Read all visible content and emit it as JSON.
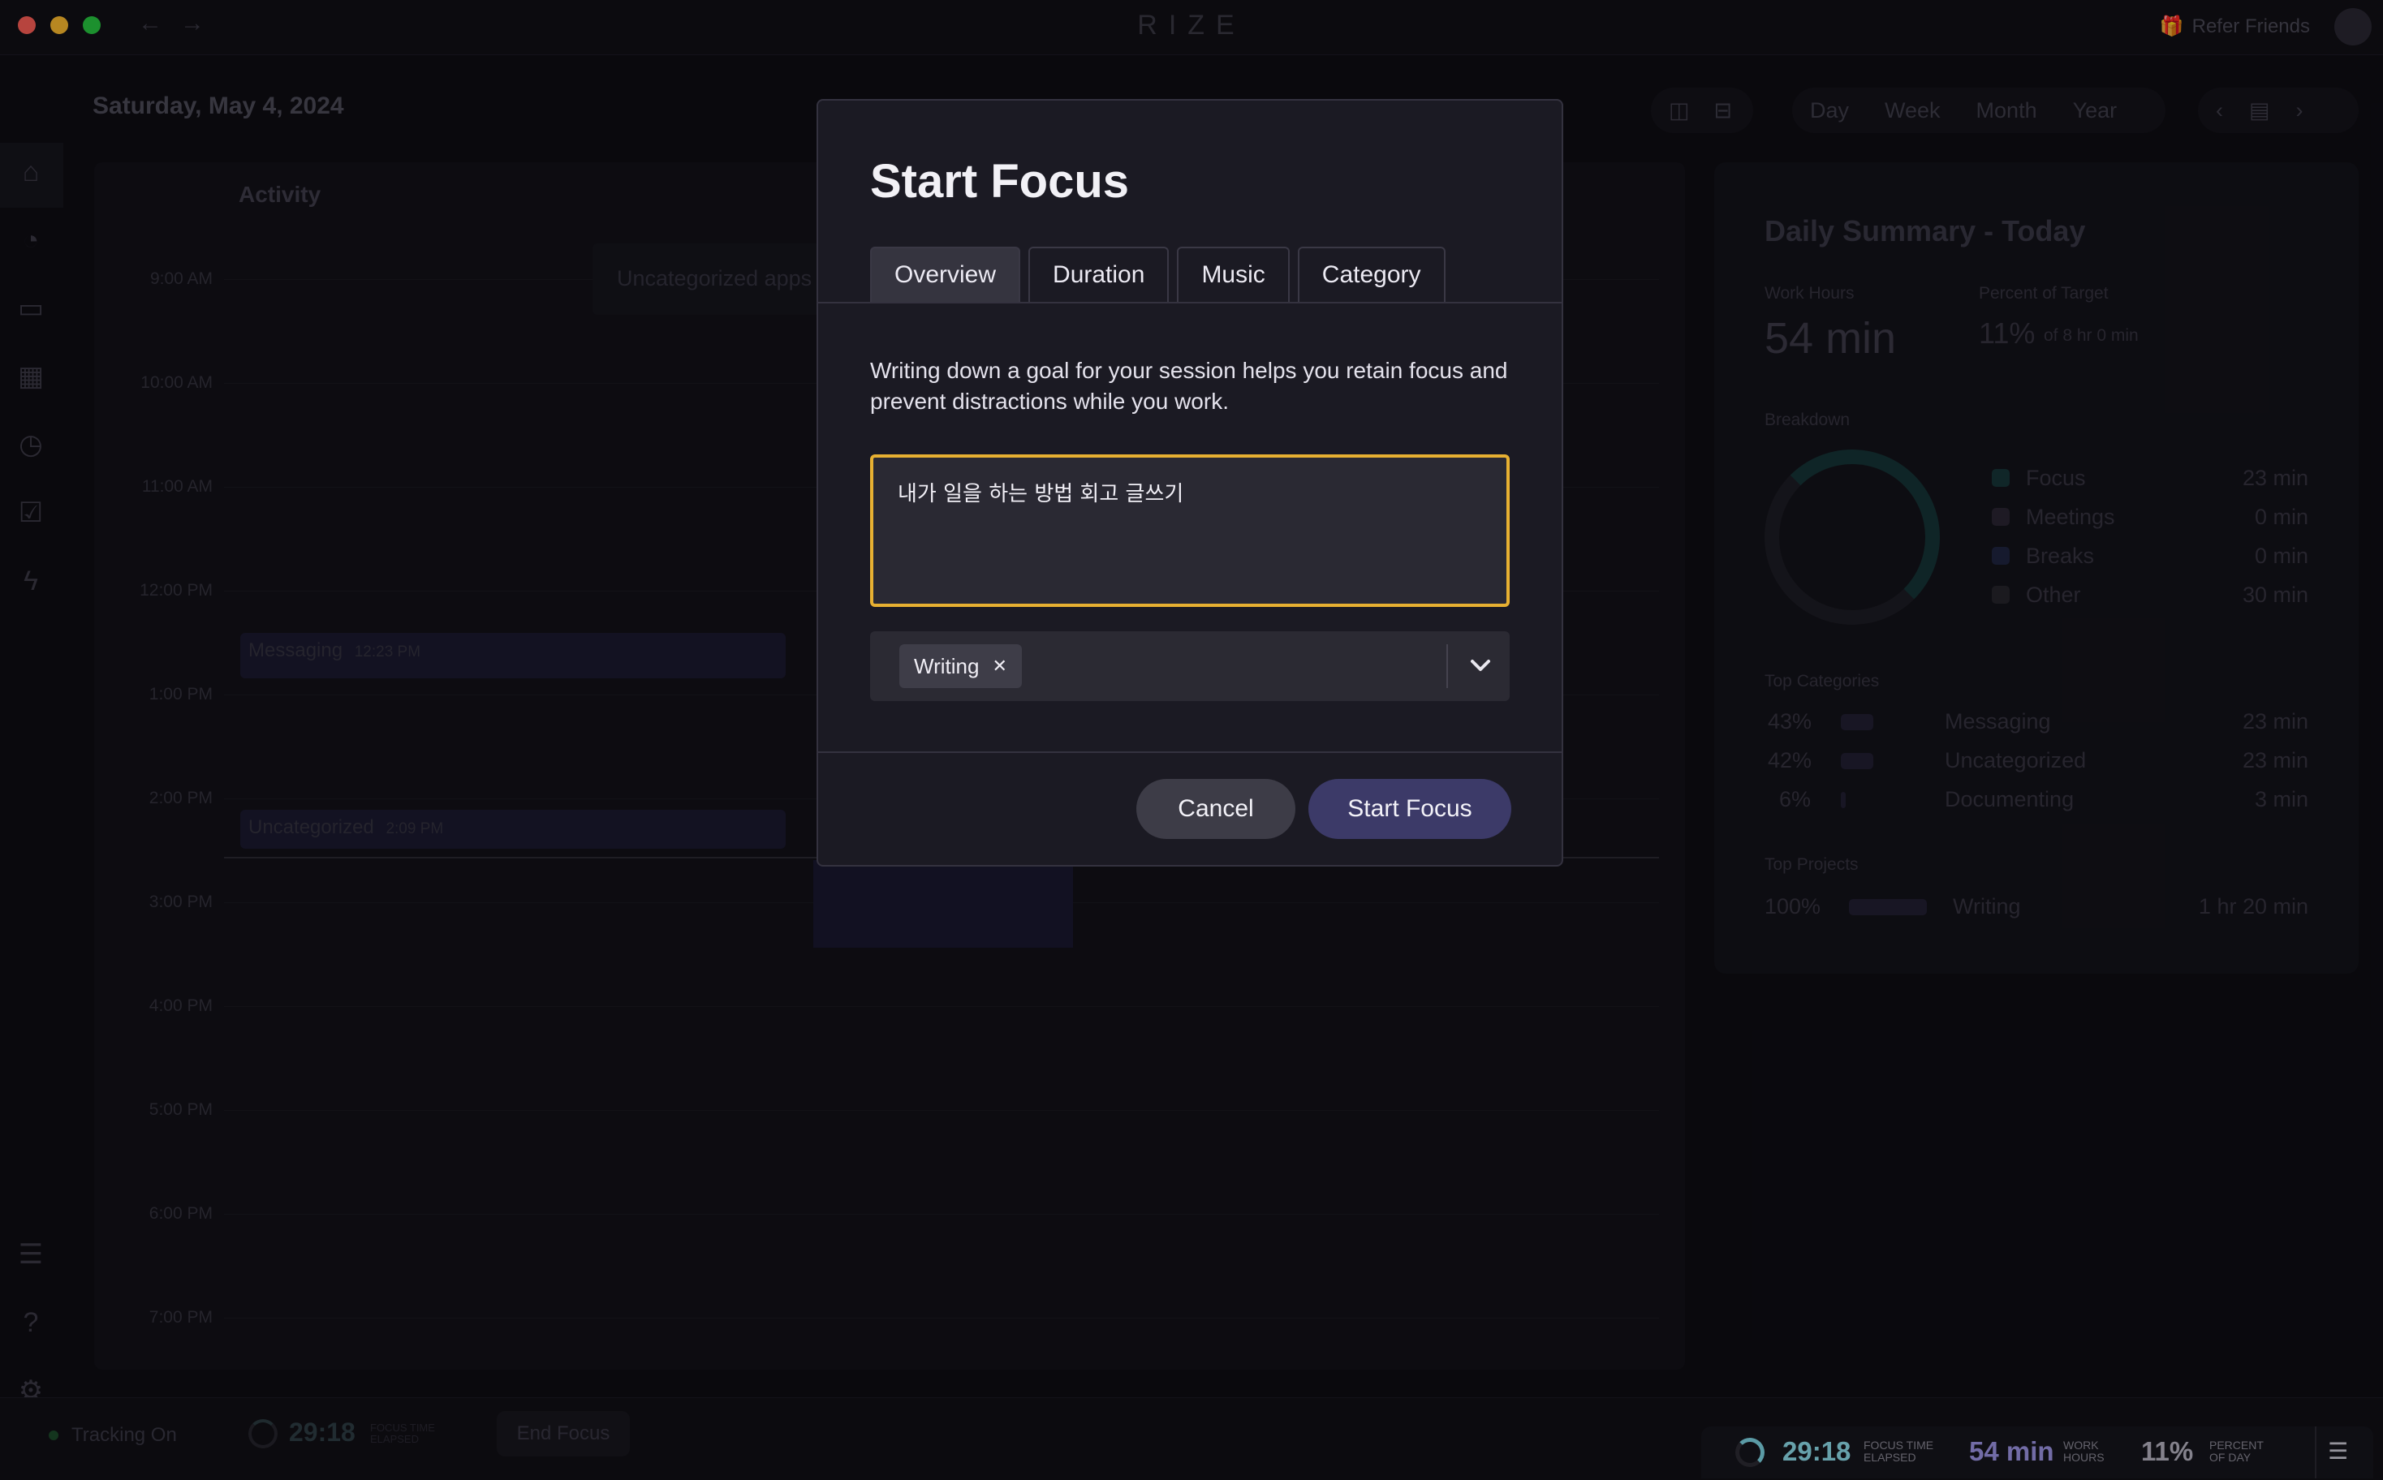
{
  "app": {
    "brand": "RIZE",
    "refer_label": "Refer Friends"
  },
  "header": {
    "date": "Saturday, May 4, 2024",
    "ranges": [
      "Day",
      "Week",
      "Month",
      "Year"
    ]
  },
  "calendar": {
    "activity_label": "Activity",
    "hours": [
      "9:00 AM",
      "10:00 AM",
      "11:00 AM",
      "12:00 PM",
      "1:00 PM",
      "2:00 PM",
      "3:00 PM",
      "4:00 PM",
      "5:00 PM",
      "6:00 PM",
      "7:00 PM"
    ],
    "events": [
      {
        "label": "Uncategorized apps",
        "time": ""
      },
      {
        "label": "Messaging",
        "time": "12:23 PM"
      },
      {
        "label": "Uncategorized",
        "time": "2:09 PM"
      }
    ]
  },
  "summary": {
    "title": "Daily Summary - Today",
    "work_hours_label": "Work Hours",
    "work_hours_value": "54 min",
    "percent_label": "Percent of Target",
    "percent_value": "11%",
    "percent_of": "of 8 hr 0 min",
    "breakdown_label": "Breakdown",
    "breakdown": [
      {
        "name": "Focus",
        "value": "23 min"
      },
      {
        "name": "Meetings",
        "value": "0 min"
      },
      {
        "name": "Breaks",
        "value": "0 min"
      },
      {
        "name": "Other",
        "value": "30 min"
      }
    ],
    "top_categories_label": "Top Categories",
    "top_categories": [
      {
        "pct": "43%",
        "name": "Messaging",
        "value": "23 min"
      },
      {
        "pct": "42%",
        "name": "Uncategorized",
        "value": "23 min"
      },
      {
        "pct": "6%",
        "name": "Documenting",
        "value": "3 min"
      }
    ],
    "top_projects_label": "Top Projects",
    "top_projects": [
      {
        "pct": "100%",
        "name": "Writing",
        "value": "1 hr 20 min"
      }
    ]
  },
  "bottombar": {
    "tracking_label": "Tracking On",
    "timer": "29:18",
    "timer_sub": "FOCUS TIME ELAPSED",
    "end_focus_label": "End Focus",
    "tracker": {
      "focus_time": "29:18",
      "focus_label_1": "FOCUS TIME",
      "focus_label_2": "ELAPSED",
      "work_hours": "54 min",
      "work_label_1": "WORK",
      "work_label_2": "HOURS",
      "percent": "11%",
      "percent_label_1": "PERCENT",
      "percent_label_2": "OF DAY"
    }
  },
  "modal": {
    "title": "Start Focus",
    "tabs": [
      "Overview",
      "Duration",
      "Music",
      "Category"
    ],
    "active_tab": "Overview",
    "description": "Writing down a goal for your session helps you retain focus and prevent distractions while you work.",
    "goal_value": "내가 일을 하는 방법 회고 글쓰기",
    "tag": "Writing",
    "cancel_label": "Cancel",
    "start_label": "Start Focus"
  }
}
